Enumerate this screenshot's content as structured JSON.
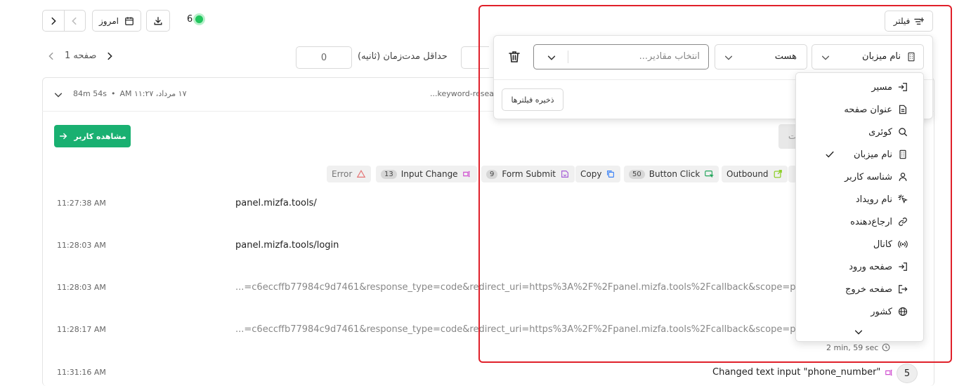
{
  "toolbar": {
    "today_label": "امروز",
    "live_count": "6",
    "filter_label": "فیلتر"
  },
  "pager": {
    "page_label": "صفحه 1"
  },
  "duration_filter": {
    "label": "حداقل مدت‌زمان (ثانیه)",
    "value": "0"
  },
  "session": {
    "date": "۱۷ مرداد، ۱۱:۲۷ AM",
    "duration": "84m 54s",
    "url_fragment": "...keyword-resea",
    "view_user_label": "مشاهده کاربر",
    "gray_button_text": "ت"
  },
  "chips": [
    {
      "label": "Error",
      "count": ""
    },
    {
      "label": "Input Change",
      "count": "13"
    },
    {
      "label": "Form Submit",
      "count": "9"
    },
    {
      "label": "Copy",
      "count": ""
    },
    {
      "label": "Button Click",
      "count": "50"
    },
    {
      "label": "Outbound",
      "count": ""
    }
  ],
  "events": [
    {
      "time": "11:27:38 AM",
      "text": "panel.mizfa.tools/"
    },
    {
      "time": "11:28:03 AM",
      "text": "panel.mizfa.tools/login"
    },
    {
      "time": "11:28:03 AM",
      "text": "...=c6eccffb77984c9d7461&response_type=code&redirect_uri=https%3A%2F%2Fpanel.mizfa.tools%2Fcallback&scope=profile&st"
    },
    {
      "time": "11:28:17 AM",
      "text": "...=c6eccffb77984c9d7461&response_type=code&redirect_uri=https%3A%2F%2Fpanel.mizfa.tools%2Fcallback&scope=profile&st"
    },
    {
      "time": "11:31:16 AM",
      "text": "Changed text input \"phone_number\"",
      "number": "5"
    }
  ],
  "duration_note": "2 min, 59 sec",
  "filter_panel": {
    "property_value": "نام میزبان",
    "operator_value": "هست",
    "values_placeholder": "انتخاب مقادیر...",
    "save_label": "ذخیره فیلترها"
  },
  "dropdown": {
    "items": [
      {
        "label": "مسیر",
        "icon": "route-icon",
        "checked": false
      },
      {
        "label": "عنوان صفحه",
        "icon": "document-icon",
        "checked": false
      },
      {
        "label": "کوئری",
        "icon": "search-icon",
        "checked": false
      },
      {
        "label": "نام میزبان",
        "icon": "building-icon",
        "checked": true
      },
      {
        "label": "شناسه کاربر",
        "icon": "user-icon",
        "checked": false
      },
      {
        "label": "نام رویداد",
        "icon": "pointer-click-icon",
        "checked": false
      },
      {
        "label": "ارجاع‌دهنده",
        "icon": "link-icon",
        "checked": false
      },
      {
        "label": "کانال",
        "icon": "broadcast-icon",
        "checked": false
      },
      {
        "label": "صفحه ورود",
        "icon": "login-icon",
        "checked": false
      },
      {
        "label": "صفحه خروج",
        "icon": "logout-icon",
        "checked": false
      },
      {
        "label": "کشور",
        "icon": "globe-icon",
        "checked": false
      }
    ]
  },
  "colors": {
    "accent_green": "#19b071",
    "live_dot": "#22c55e",
    "highlight_red": "#e0202a"
  }
}
